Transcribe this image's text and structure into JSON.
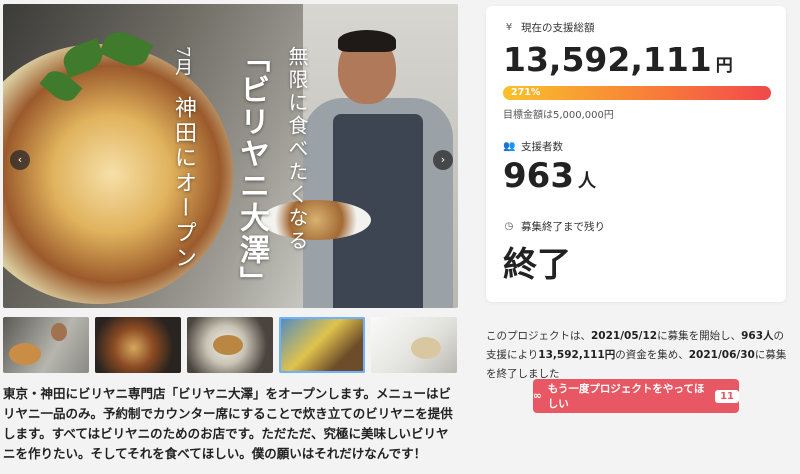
{
  "hero": {
    "title_vertical": "「ビリヤニ大澤」",
    "subtitle_vertical": "無限に食べたくなる",
    "date_vertical": "7月",
    "place_vertical": "神田にオープン",
    "prev_arrow": "‹",
    "next_arrow": "›"
  },
  "description": "東京・神田にビリヤニ専門店「ビリヤニ大澤」をオープンします。メニューはビリヤニ一品のみ。予約制でカウンター席にすることで炊き立てのビリヤニを提供します。すべてはビリヤニのためのお店です。ただただ、究極に美味しいビリヤニを作りたい。そしてそれを食べてほしい。僕の願いはそれだけなんです！",
  "stats": {
    "total_label": "現在の支援総額",
    "total_amount": "13,592,111",
    "total_unit": "円",
    "progress_percent": 271,
    "progress_label": "271%",
    "goal_label": "目標金額は5,000,000円",
    "backers_label": "支援者数",
    "backers_count": "963",
    "backers_unit": "人",
    "remaining_label": "募集終了まで残り",
    "remaining_value": "終了"
  },
  "summary": {
    "p1": "このプロジェクトは、",
    "start_date": "2021/05/12",
    "p2": "に募集を開始し、",
    "backers": "963人",
    "p3": "の支援により",
    "amount": "13,592,111円",
    "p4": "の資金を集め、",
    "end_date": "2021/06/30",
    "p5": "に募集を終了しました"
  },
  "cta": {
    "label": "もう一度プロジェクトをやってほしい",
    "count": "11"
  },
  "icons": {
    "yen": "yen-icon",
    "users": "users-icon",
    "clock": "clock-icon",
    "infinity": "infinity-icon"
  }
}
